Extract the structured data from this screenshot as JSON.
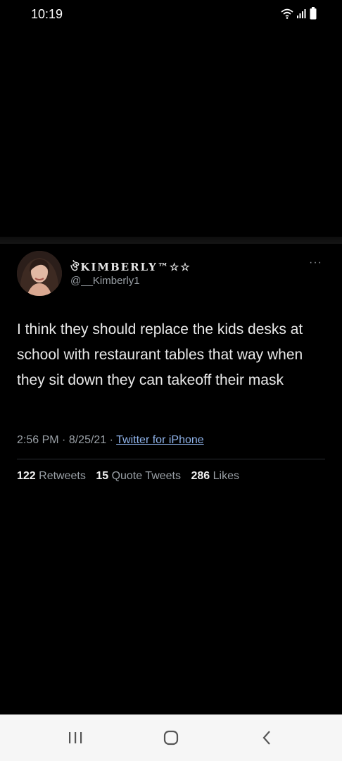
{
  "status_bar": {
    "time": "10:19",
    "icons": [
      "wifi-icon",
      "signal-icon",
      "battery-icon"
    ]
  },
  "tweet": {
    "display_name": "ঔKIMBERLY™☆☆",
    "handle": "@__Kimberly1",
    "more_label": "···",
    "text": "I think they should replace the kids desks at school with restaurant tables that way when they sit down they can takeoff their mask",
    "time": "2:56 PM",
    "date": "8/25/21",
    "separator": "·",
    "source": "Twitter for iPhone",
    "stats": {
      "retweets_count": "122",
      "retweets_label": "Retweets",
      "quote_count": "15",
      "quote_label": "Quote Tweets",
      "likes_count": "286",
      "likes_label": "Likes"
    }
  },
  "nav_bar": {
    "buttons": [
      "recent-apps-icon",
      "home-icon",
      "back-icon"
    ]
  },
  "colors": {
    "background": "#000000",
    "text": "#e9e9e9",
    "secondary_text": "#9aa0a6",
    "link": "#8fb3ea",
    "nav_bar": "#f6f6f6"
  }
}
